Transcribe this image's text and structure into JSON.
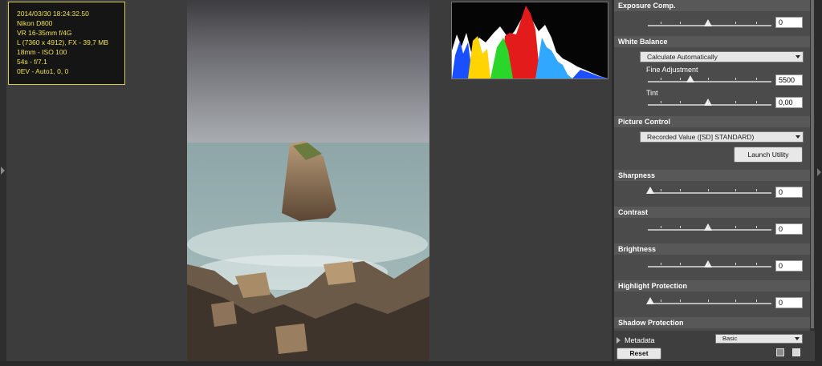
{
  "image_info": {
    "lines": [
      "2014/03/30 18:24:32.50",
      "Nikon D800",
      "VR 16-35mm f/4G",
      "L (7360 x 4912), FX - 39,7 MB",
      "18mm - ISO 100",
      "54s - f/7.1",
      "0EV - Auto1, 0, 0"
    ]
  },
  "panel": {
    "exposure": {
      "label": "Exposure Comp.",
      "value": "0",
      "level": 0.5
    },
    "white_balance": {
      "label": "White Balance",
      "mode": "Calculate Automatically",
      "fine_label": "Fine Adjustment",
      "fine_value": "5500",
      "fine_level": 0.35,
      "tint_label": "Tint",
      "tint_value": "0,00",
      "tint_level": 0.5
    },
    "picture_control": {
      "label": "Picture Control",
      "mode": "Recorded Value ([SD] STANDARD)",
      "launch_label": "Launch Utility"
    },
    "sharpness": {
      "label": "Sharpness",
      "value": "0",
      "level": 0.0
    },
    "contrast": {
      "label": "Contrast",
      "value": "0",
      "level": 0.5
    },
    "brightness": {
      "label": "Brightness",
      "value": "0",
      "level": 0.5
    },
    "highlight": {
      "label": "Highlight Protection",
      "value": "0",
      "level": 0.0
    },
    "shadow": {
      "label": "Shadow Protection"
    }
  },
  "bottom": {
    "metadata_label": "Metadata",
    "metadata_mode": "Basic",
    "reset_label": "Reset"
  },
  "colors": {
    "info_text": "#efe25a",
    "info_border": "#d8cf3a",
    "panel_bg": "#4b4b4b",
    "section_header": "#585858"
  },
  "icons": {
    "disclosure": "triangle-right-icon",
    "copy": "copy-settings-icon",
    "save": "save-icon"
  }
}
